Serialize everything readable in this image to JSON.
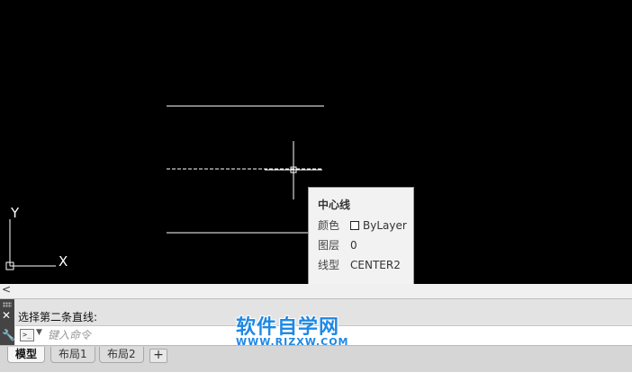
{
  "tooltip": {
    "title": "中心线",
    "rows": [
      {
        "key": "颜色",
        "value": "ByLayer",
        "swatch": true
      },
      {
        "key": "图层",
        "value": "0"
      },
      {
        "key": "线型",
        "value": "CENTER2"
      }
    ]
  },
  "ucs": {
    "y_label": "Y",
    "x_label": "X"
  },
  "scrollbar": {
    "left_arrow": "<"
  },
  "command": {
    "history": "选择第二条直线:",
    "input_placeholder": "键入命令",
    "prompt_icon": ">_"
  },
  "tabs": [
    {
      "label": "模型",
      "active": true
    },
    {
      "label": "布局1",
      "active": false
    },
    {
      "label": "布局2",
      "active": false
    }
  ],
  "add_tab": "+",
  "watermark": {
    "text": "软件自学网",
    "url": "WWW.RJZXW.COM"
  },
  "colors": {
    "canvas": "#000000",
    "drawing": "#ffffff",
    "brand": "#1e88e5"
  }
}
